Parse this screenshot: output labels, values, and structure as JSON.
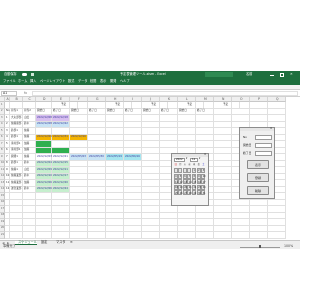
{
  "window": {
    "app_label": "自動保存",
    "title": "予定表管理ツール.xlsm - Excel",
    "user": "名前"
  },
  "ribbon_tabs": [
    "ファイル",
    "ホーム",
    "挿入",
    "ページレイアウト",
    "数式",
    "データ",
    "校閲",
    "表示",
    "開発",
    "ヘルプ"
  ],
  "formula": {
    "name_box": "A1",
    "fx": "fx",
    "value": ""
  },
  "columns": [
    "A",
    "B",
    "C",
    "D",
    "E",
    "F",
    "G",
    "H",
    "I",
    "J",
    "K",
    "L",
    "M",
    "N",
    "O",
    "P",
    "Q"
  ],
  "sheet": {
    "group_headers": [
      "予定",
      "予定",
      "予定",
      "予定",
      "予定"
    ],
    "headers": [
      "No",
      "担当1",
      "担当2",
      "開始日",
      "終了日",
      "開始日",
      "終了日",
      "開始日",
      "終了日",
      "開始日",
      "終了日",
      "開始日",
      "終了日"
    ],
    "rows": [
      {
        "no": "1",
        "p1": "大丸部部",
        "p2": "山田",
        "c1": "2022/12/08",
        "c2": "2022/12/18",
        "c3": "",
        "c4": "",
        "c5": "",
        "c6": ""
      },
      {
        "no": "2",
        "p1": "佐藤康部",
        "p2": "鈴木",
        "c1": "2022/12/08",
        "c2": "2022/12/22",
        "c3": "",
        "c4": "",
        "c5": "",
        "c6": ""
      },
      {
        "no": "3",
        "p1": "鈴部1",
        "p2": "佐藤",
        "c1": "",
        "c2": "",
        "c3": "",
        "c4": "",
        "c5": "",
        "c6": ""
      },
      {
        "no": "4",
        "p1": "鈴部1",
        "p2": "佐藤",
        "c1": "2022/12/04",
        "c2": "2022/12/31",
        "c3": "2022/12/16",
        "c4": "",
        "c5": "",
        "c6": ""
      },
      {
        "no": "5",
        "p1": "東村部1",
        "p2": "加藤",
        "c1": "",
        "c2": "",
        "c3": "",
        "c4": "",
        "c5": "",
        "c6": ""
      },
      {
        "no": "6",
        "p1": "東村部1",
        "p2": "加藤",
        "c1": "",
        "c2": "",
        "c3": "",
        "c4": "",
        "c5": "",
        "c6": ""
      },
      {
        "no": "7",
        "p1": "開発1",
        "p2": "佐藤",
        "c1": "2022/12/03",
        "c2": "2022/12/21",
        "c3": "2022/05/03",
        "c4": "2022/05/30",
        "c5": "2022/05/19",
        "c6": "2022/06/16"
      },
      {
        "no": "8",
        "p1": "鈴部1",
        "p2": "鈴木",
        "c1": "2022/12/04",
        "c2": "2022/12/15",
        "c3": "",
        "c4": "",
        "c5": "",
        "c6": ""
      },
      {
        "no": "9",
        "p1": "佐藤1",
        "p2": "山田",
        "c1": "2022/12/09",
        "c2": "2022/12/11",
        "c3": "",
        "c4": "",
        "c5": "",
        "c6": ""
      },
      {
        "no": "10",
        "p1": "佐藤業部",
        "p2": "鈴木",
        "c1": "2022/12/10",
        "c2": "2022/12/17",
        "c3": "",
        "c4": "",
        "c5": "",
        "c6": ""
      },
      {
        "no": "11",
        "p1": "佐藤業部",
        "p2": "加藤",
        "c1": "2022/12/06",
        "c2": "2022/12/20",
        "c3": "",
        "c4": "",
        "c5": "",
        "c6": ""
      },
      {
        "no": "12",
        "p1": "運営業部",
        "p2": "鈴木",
        "c1": "2022/12/06",
        "c2": "2022/12/24",
        "c3": "",
        "c4": "",
        "c5": "",
        "c6": ""
      }
    ]
  },
  "calendar": {
    "year_value": "2022",
    "month_value": "12",
    "weekdays": [
      "日",
      "月",
      "火",
      "水",
      "木",
      "金",
      "土"
    ],
    "days": [
      "",
      "",
      "",
      "",
      "1",
      "2",
      "3",
      "4",
      "5",
      "6",
      "7",
      "8",
      "9",
      "10",
      "11",
      "12",
      "13",
      "14",
      "15",
      "16",
      "17",
      "18",
      "19",
      "20",
      "21",
      "22",
      "23",
      "24",
      "25",
      "26",
      "27",
      "28",
      "29",
      "30",
      "31"
    ]
  },
  "form": {
    "fields": [
      {
        "label": "No",
        "value": ""
      },
      {
        "label": "開始日",
        "value": ""
      },
      {
        "label": "終了日",
        "value": ""
      }
    ],
    "buttons": [
      "表示",
      "登録",
      "削除"
    ]
  },
  "sheet_tabs": [
    "スケジュール",
    "設定",
    "マスタ"
  ],
  "status": {
    "left": "準備完了",
    "zoom": "100%"
  },
  "colors": {
    "excel_green": "#1e6f3e",
    "lavender": "#d8bff0",
    "light_green": "#c6efce",
    "light_blue": "#c9e4f5",
    "orange": "#f4b400",
    "green": "#2eaf4f",
    "cyan": "#a6e6f0"
  }
}
